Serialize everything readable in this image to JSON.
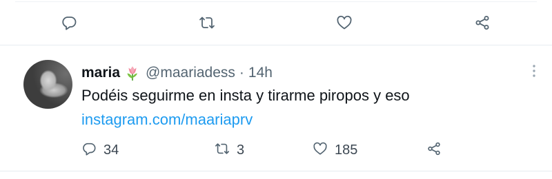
{
  "tweet": {
    "display_name": "maria",
    "handle": "@maariadess",
    "separator": "·",
    "time": "14h",
    "text": "Podéis seguirme en insta y tirarme piropos y eso",
    "link": "instagram.com/maariaprv",
    "emoji": "tulip-emoji",
    "counts": {
      "replies": "34",
      "retweets": "3",
      "likes": "185"
    }
  },
  "colors": {
    "link": "#1d9bf0",
    "muted": "#536471",
    "text": "#0f1419",
    "divider": "#e6ecf0"
  },
  "icons": [
    "reply-icon",
    "retweet-icon",
    "like-icon",
    "share-icon",
    "more-icon",
    "tulip-emoji"
  ]
}
